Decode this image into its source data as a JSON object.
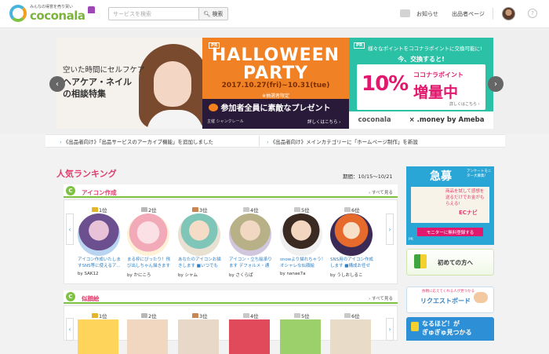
{
  "header": {
    "logo_tagline": "みんなの得意を売り買い",
    "logo_text": "coconala",
    "search_placeholder": "サービスを検索",
    "search_button": "検索",
    "notice_label": "お知らせ",
    "seller_page_label": "出品者ページ",
    "help_label": "?"
  },
  "banners": {
    "left": {
      "line1": "空いた時間にセルフケア",
      "line2": "ヘアケア・ネイル",
      "line3": "の相談特集"
    },
    "middle": {
      "tag": "PR",
      "title1": "HALLOWEEN",
      "title2": "PARTY",
      "dates": "2017.10.27(fri)~10.31(tue)",
      "limited": "※抽選者限定",
      "present": "参加者全員に素敵なプレゼント",
      "host": "主催  シャンクレール",
      "more": "詳しくはこちら ›"
    },
    "right": {
      "tag": "PR",
      "line1": "様々なポイントをココナラポイントに交換可能に!",
      "line2": "今、交換すると!",
      "big": "10%",
      "label": "ココナラポイント",
      "increase": "増量中",
      "detail": "詳しくはこちら ›",
      "brand1": "coconala",
      "brand2": "× .money by Ameba"
    },
    "prev": "‹",
    "next": "›"
  },
  "news": [
    "《出品者向け》「出品サービスのアーカイブ機能」を追加しました",
    "《出品者向け》メインカテゴリーに「ホームページ制作」を新設"
  ],
  "ranking": {
    "title": "人気ランキング",
    "period": "期間：10/15〜10/21",
    "sections": [
      {
        "title": "アイコン作成",
        "see_all": "› すべて見る",
        "items": [
          {
            "rank": "1位",
            "desc": "アイコン作成いたしますSNS等に使えるア...",
            "seller": "by SAK12"
          },
          {
            "rank": "2位",
            "desc": "まる枠にぴったり！飛び出しちゃん描きます",
            "seller": "by かにころ"
          },
          {
            "rank": "3位",
            "desc": "あなたのアイコンお描きします ■いつでも",
            "seller": "by シャム"
          },
          {
            "rank": "4位",
            "desc": "アイコン・立ち絵承ります デフォルメ・通",
            "seller": "by さくらぱ"
          },
          {
            "rank": "5位",
            "desc": "snowより描れちゃう！オシャレな似顔絵",
            "seller": "by nanae7a"
          },
          {
            "rank": "6位",
            "desc": "SNS用のアイコン作成します ■構成お任せ",
            "seller": "by うしおしるこ"
          }
        ]
      },
      {
        "title": "似顔絵",
        "see_all": "› すべて見る",
        "items": [
          {
            "rank": "1位"
          },
          {
            "rank": "2位"
          },
          {
            "rank": "3位"
          },
          {
            "rank": "4位"
          },
          {
            "rank": "5位"
          },
          {
            "rank": "6位"
          }
        ]
      }
    ]
  },
  "sidebar": {
    "ad_title": "急募",
    "ad_sub": "アンケートモニター大募集!",
    "ad_text": "商品を試して感想を送るだけでお金がもらえる!",
    "ad_brand": "ECナビ",
    "ad_button": "モニターに無料登録する",
    "ad_pr": "PR",
    "beginner": "初めての方へ",
    "request_sub": "依頼に応えてくれる人が見つかる",
    "request": "リクエストボード",
    "naruhodo": "なるほど！が\nぎゅぎゅ見つかる"
  },
  "colors": {
    "accent_pink": "#e23d6e",
    "brand_green": "#7ec242",
    "link_blue": "#2f7fc1",
    "halloween_orange": "#f08124",
    "points_teal": "#2bc1a7"
  }
}
